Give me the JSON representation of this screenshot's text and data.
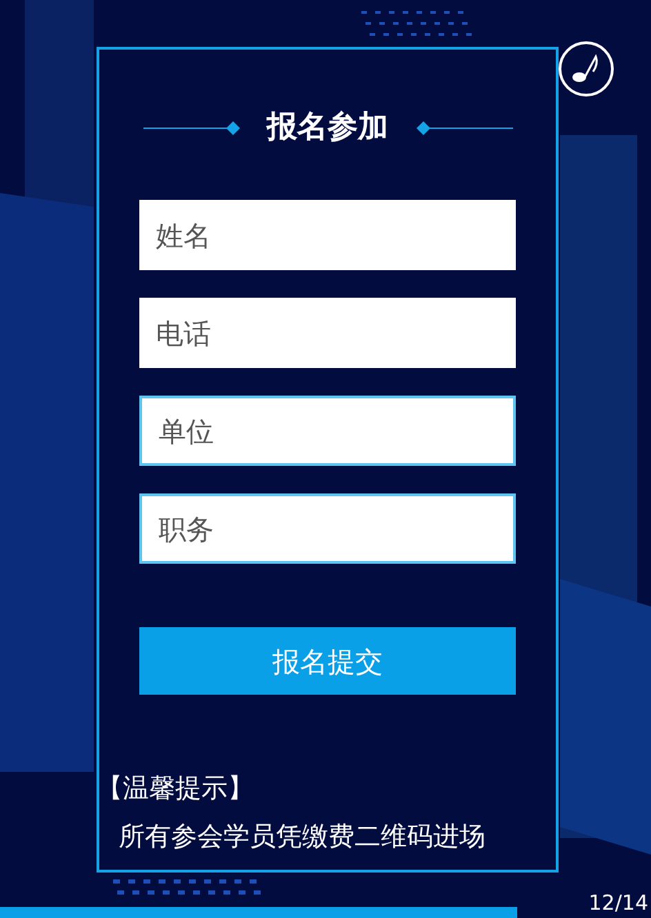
{
  "form": {
    "title": "报名参加",
    "fields": [
      {
        "placeholder": "姓名",
        "outlined": false
      },
      {
        "placeholder": "电话",
        "outlined": false
      },
      {
        "placeholder": "单位",
        "outlined": true
      },
      {
        "placeholder": "职务",
        "outlined": true
      }
    ],
    "submit": "报名提交"
  },
  "notice": {
    "heading": "【温馨提示】",
    "text": "所有参会学员凭缴费二维码进场"
  },
  "page_indicator": "12/14"
}
